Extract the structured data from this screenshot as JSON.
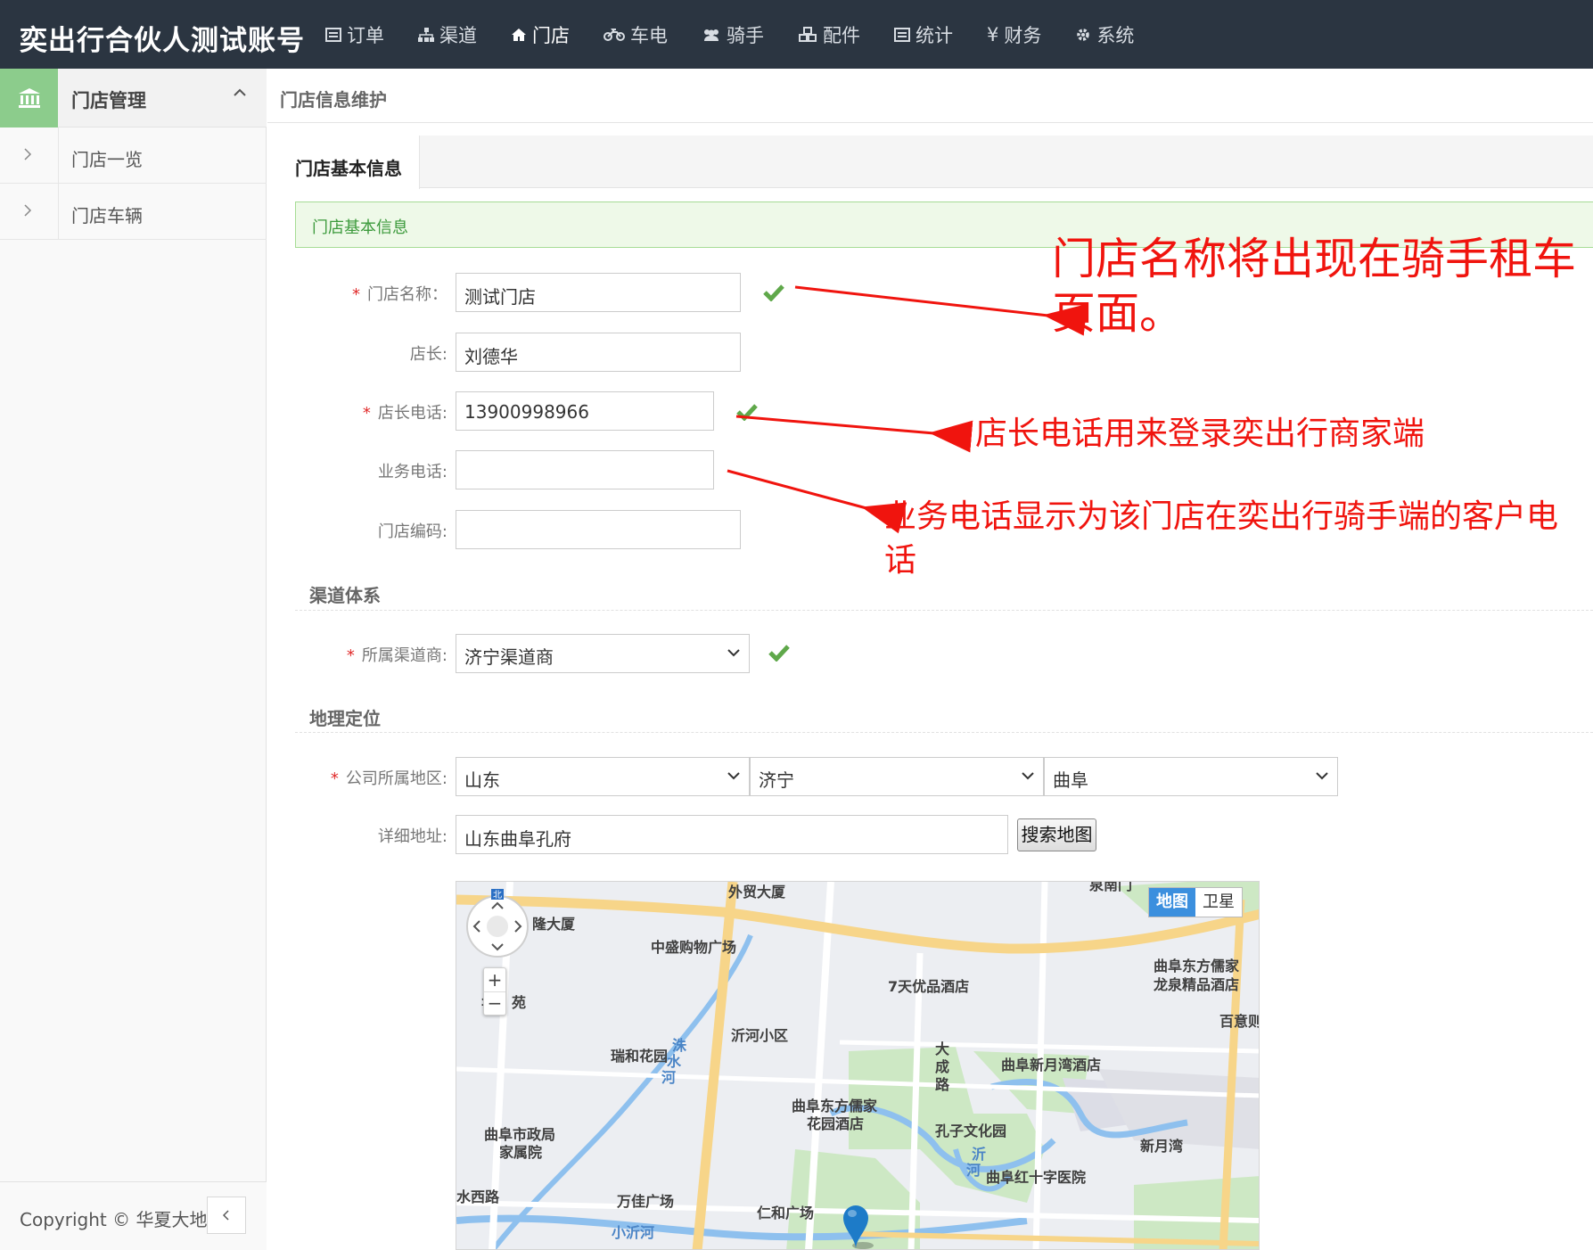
{
  "brand": "奕出行合伙人测试账号",
  "nav": [
    {
      "label": "订单",
      "icon": "list-icon"
    },
    {
      "label": "渠道",
      "icon": "sitemap-icon"
    },
    {
      "label": "门店",
      "icon": "home-icon"
    },
    {
      "label": "车电",
      "icon": "motorcycle-icon"
    },
    {
      "label": "骑手",
      "icon": "users-icon"
    },
    {
      "label": "配件",
      "icon": "cubes-icon"
    },
    {
      "label": "统计",
      "icon": "chart-icon"
    },
    {
      "label": "财务",
      "icon": "yen-icon"
    },
    {
      "label": "系统",
      "icon": "gear-icon"
    }
  ],
  "sidebar": {
    "group": "门店管理",
    "items": [
      {
        "label": "门店一览"
      },
      {
        "label": "门店车辆"
      }
    ],
    "copyright": "Copyright © 华夏大地"
  },
  "breadcrumb": "门店信息维护",
  "tab": "门店基本信息",
  "info": "门店基本信息",
  "form": {
    "store_name": {
      "label": "门店名称：",
      "value": "测试门店"
    },
    "manager": {
      "label": "店长:",
      "value": "刘德华"
    },
    "manager_phone": {
      "label": "店长电话:",
      "value": "13900998966"
    },
    "business_phone": {
      "label": "业务电话:",
      "value": ""
    },
    "store_code": {
      "label": "门店编码:",
      "value": ""
    },
    "channel_section": "渠道体系",
    "channel": {
      "label": "所属渠道商:",
      "value": "济宁渠道商"
    },
    "geo_section": "地理定位",
    "region": {
      "label": "公司所属地区:",
      "province": "山东",
      "city": "济宁",
      "district": "曲阜"
    },
    "address": {
      "label": "详细地址:",
      "value": "山东曲阜孔府"
    },
    "search_button": "搜索地图"
  },
  "map": {
    "toggle": [
      "地图",
      "卫星"
    ],
    "labels": [
      "外贸大厦",
      "隆大厦",
      "中盛购物广场",
      "7天优品酒店",
      "曲阜东方儒家",
      "龙泉精品酒店",
      "百意则",
      "沂河小区",
      "瑞和花园",
      "大",
      "成",
      "路",
      "曲阜新月湾酒店",
      "曲阜东方儒家",
      "花园酒店",
      "孔子文化园",
      "新月湾",
      "曲阜市政局",
      "家属院",
      "曲阜红十字医院",
      "水西路",
      "万佳广场",
      "仁和广场",
      "小沂河",
      "华",
      "苑",
      "泉南门",
      "洙",
      "水",
      "河",
      "沂",
      "河"
    ]
  },
  "annotations": {
    "a1": "门店名称将出现在骑手租车",
    "a1b": "页面。",
    "a2": "店长电话用来登录奕出行商家端",
    "a3": "业务电话显示为该门店在奕出行骑手端的客户电",
    "a3b": "话"
  },
  "colors": {
    "topbar": "#2b3541",
    "accent_green": "#8ccc8c",
    "annotation_red": "#f0140e"
  }
}
